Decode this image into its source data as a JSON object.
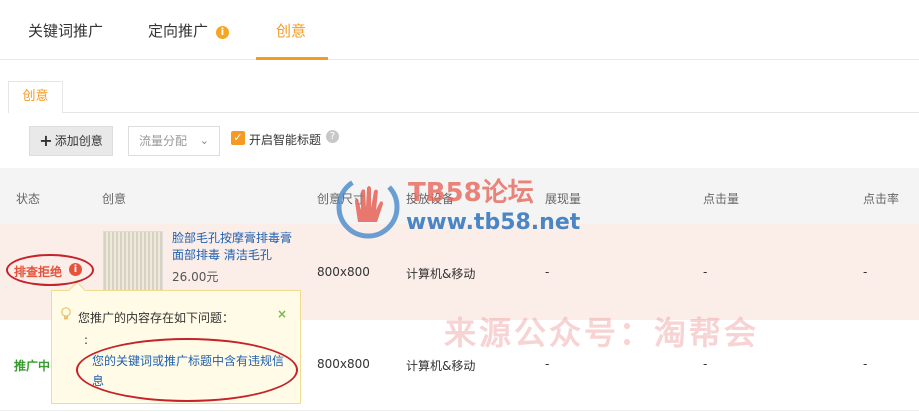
{
  "tabs": [
    {
      "label": "关键词推广"
    },
    {
      "label": "定向推广"
    },
    {
      "label": "创意"
    }
  ],
  "tab_info_icon": "i",
  "subtab": {
    "label": "创意"
  },
  "toolbar": {
    "add_label": "添加创意",
    "flow_placeholder": "流量分配",
    "smart_title_label": "开启智能标题",
    "help_icon": "?"
  },
  "columns": [
    "状态",
    "创意",
    "创意尺寸",
    "投放设备",
    "展现量",
    "点击量",
    "点击率"
  ],
  "rows": [
    {
      "status": "排查拒绝",
      "status_icon": "i",
      "title": "脸部毛孔按摩膏排毒膏面部排毒 清洁毛孔",
      "price": "26.00元",
      "size": "800x800",
      "device": "计算机&移动",
      "impressions": "-",
      "clicks": "-",
      "ctr": "-"
    },
    {
      "status": "推广中",
      "size": "800x800",
      "device": "计算机&移动",
      "impressions": "-",
      "clicks": "-",
      "ctr": "-"
    }
  ],
  "popover": {
    "title": "您推广的内容存在如下问题：",
    "bullet": ":",
    "message": "您的关键词或推广标题中含有违规信息",
    "close": "×"
  },
  "watermark": {
    "title": "TB58论坛",
    "url": "www.tb58.net",
    "source": "来源公众号：淘帮会"
  },
  "colors": {
    "accent": "#f59a23",
    "reject": "#e5533c",
    "live": "#3a9b2e",
    "link": "#1f5fb0",
    "row_highlight": "#fbeee9",
    "annotation": "#c52229"
  }
}
